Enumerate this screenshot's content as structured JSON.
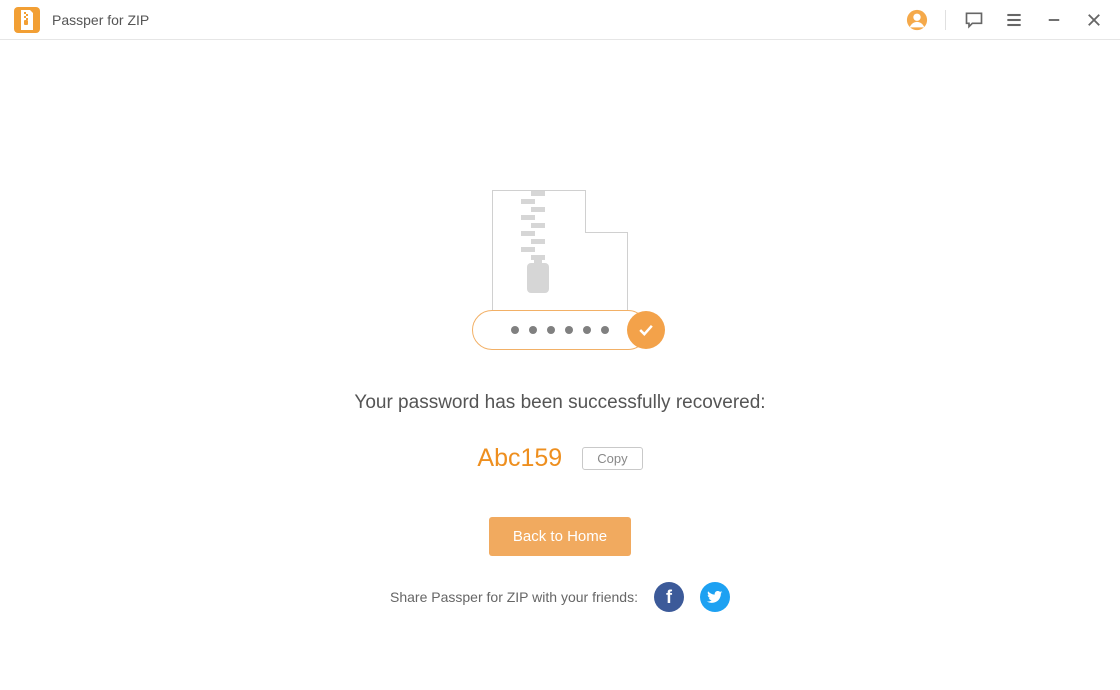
{
  "header": {
    "title": "Passper for ZIP"
  },
  "main": {
    "success_message": "Your password has been successfully recovered:",
    "password": "Abc159",
    "copy_label": "Copy",
    "home_label": "Back to Home",
    "share_text": "Share Passper for ZIP with your friends:"
  },
  "colors": {
    "accent": "#f3a24a",
    "facebook": "#3c5a99",
    "twitter": "#1da1f2"
  }
}
